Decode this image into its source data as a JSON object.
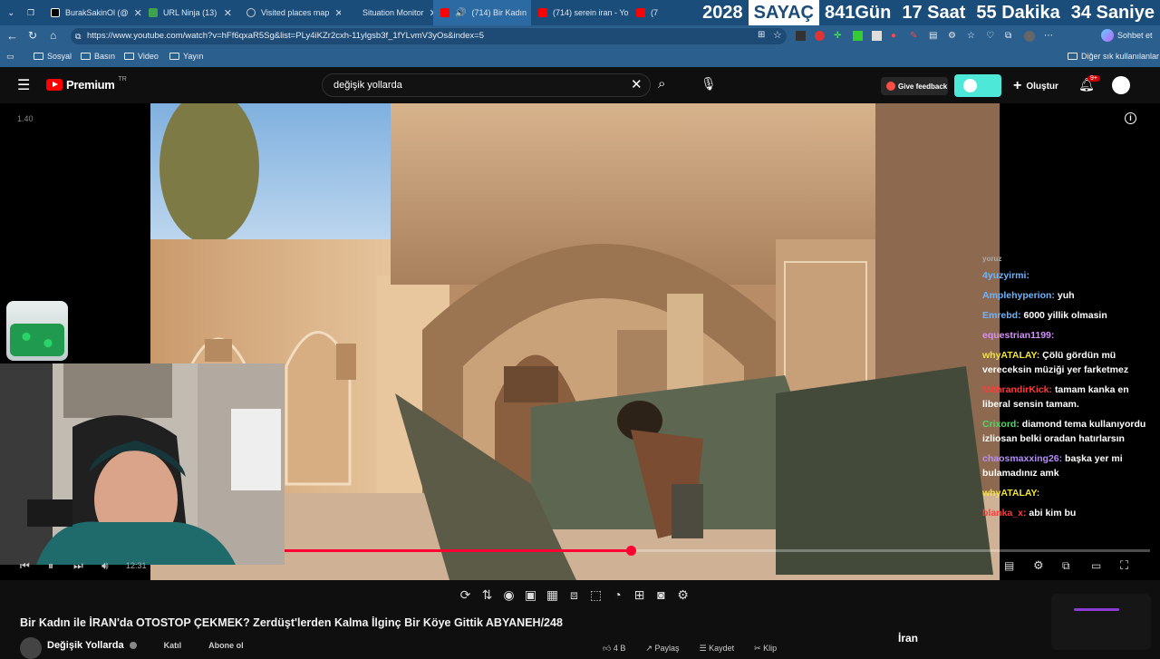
{
  "browser": {
    "tabs": [
      {
        "label": "BurakSakinOl (@",
        "color": "#ffffff"
      },
      {
        "label": "URL Ninja (13)",
        "color": "#3fa34d"
      },
      {
        "label": "Visited places map",
        "color": "#cccccc"
      },
      {
        "label": "Situation Monitor",
        "color": "#1b4d7a"
      },
      {
        "label": "(714) Bir Kadın",
        "color": "#ff0000"
      },
      {
        "label": "(714) serein iran - Yo",
        "color": "#ff0000"
      },
      {
        "label": "(7",
        "color": "#ff0000"
      }
    ],
    "counter": {
      "year": "2028",
      "label": "SAYAÇ",
      "days": "841Gün",
      "hours": "17 Saat",
      "minutes": "55 Dakika",
      "seconds": "34 Saniye"
    },
    "url": "https://www.youtube.com/watch?v=hFf6qxaR5Sg&list=PLy4iKZr2cxh-11ylgsb3f_1fYLvmV3yOs&index=5",
    "chat_button": "Sohbet et",
    "bookmarks": [
      "Sosyal",
      "Basın",
      "Video",
      "Yayın"
    ],
    "other_bookmarks": "Diğer sık kullanılanlar"
  },
  "yt": {
    "logo_text": "Premium",
    "logo_region": "TR",
    "search_value": "değişik yollarda",
    "feedback_label": "Give feedback",
    "create_label": "Oluştur",
    "notif_badge": "9+"
  },
  "player": {
    "speed_label": "1.40",
    "time": "12:31",
    "progress_percent": 40
  },
  "chat": [
    {
      "user": "",
      "text": "yoruz",
      "color": "#ffffff"
    },
    {
      "user": "4yuzyirmi:",
      "text": "",
      "color": "#6bb5ff"
    },
    {
      "user": "Amplehyperion:",
      "text": "yuh",
      "color": "#6bb5ff"
    },
    {
      "user": "Emrebd:",
      "text": "6000 yillik olmasin",
      "color": "#6bb5ff"
    },
    {
      "user": "equestrian1199:",
      "text": "",
      "color": "#d58fff"
    },
    {
      "user": "whyATALAY:",
      "text": "Çölü gördün mü vereceksin müziği yer farketmez",
      "color": "#f2e436"
    },
    {
      "user": "MithrandirKick:",
      "text": "tamam kanka en liberal sensin tamam.",
      "color": "#ff3a3a"
    },
    {
      "user": "Crixord:",
      "text": "diamond tema kullanıyordu izliosan belki oradan hatırlarsın",
      "color": "#4dd96a"
    },
    {
      "user": "chaosmaxxing26:",
      "text": "başka yer mi bulamadınız amk",
      "color": "#b58cff"
    },
    {
      "user": "whyATALAY:",
      "text": "",
      "color": "#f2e436"
    },
    {
      "user": "blanka_x:",
      "text": "abi kim bu",
      "color": "#ff3a3a"
    }
  ],
  "video": {
    "title": "Bir Kadın ile İRAN'da OTOSTOP ÇEKMEK? Zerdüşt'lerden Kalma İlginç Bir Köye Gittik ABYANEH/248",
    "channel": "Değişik Yollarda",
    "join_label": "Katıl",
    "subscribe_label": "Abone ol",
    "share_label": "Paylaş",
    "save_label": "Kaydet",
    "clip_label": "Klip",
    "like_count": "4 B",
    "chip": "İran"
  }
}
